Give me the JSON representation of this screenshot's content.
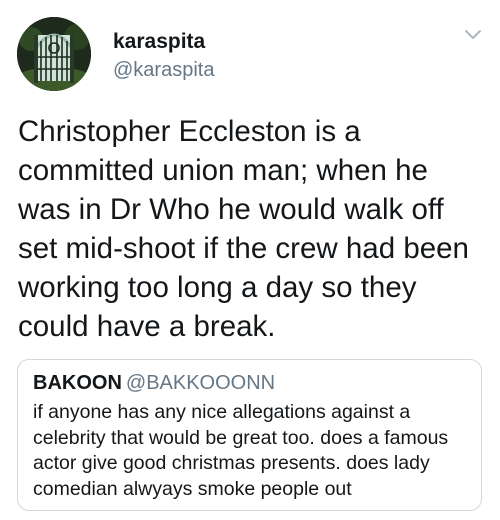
{
  "tweet": {
    "display_name": "karaspita",
    "handle": "@karaspita",
    "avatar_icon": "garden-gate-avatar",
    "menu_icon": "chevron-down-icon",
    "text": "Christopher Eccleston is a committed union man; when he was in Dr Who he would walk off set mid-shoot if the crew had been working too long a day so they could have a break."
  },
  "quote": {
    "display_name": "BAKOON",
    "handle": "@BAKKOOONN",
    "text": "if anyone has any nice allegations against a celebrity that would be great too. does a famous actor give good christmas presents. does lady comedian alwyays smoke people out"
  },
  "colors": {
    "text": "#14171a",
    "secondary_text": "#657786",
    "border": "#cfd9de"
  }
}
